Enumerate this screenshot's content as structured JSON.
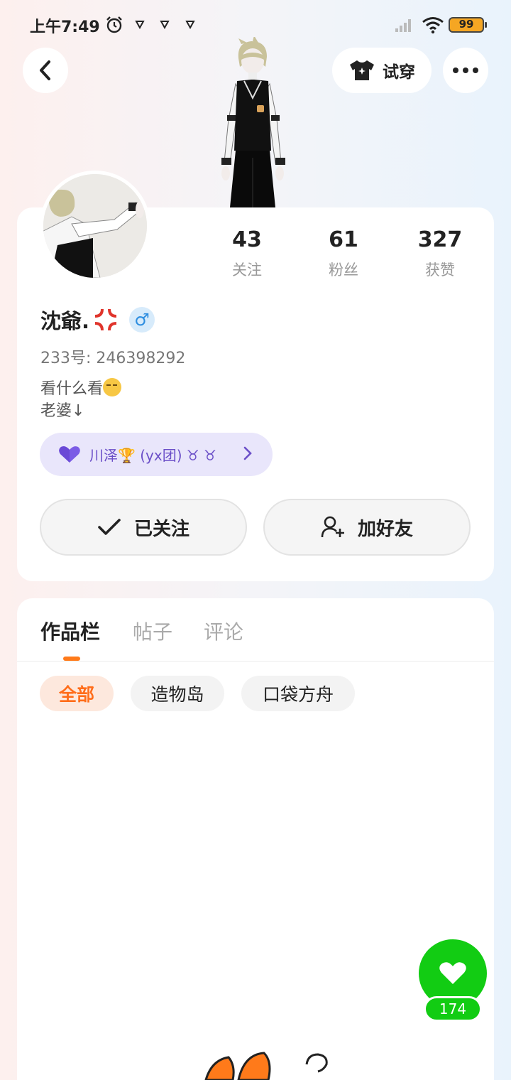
{
  "status_bar": {
    "time": "上午7:49",
    "battery": "99"
  },
  "header": {
    "tryon_label": "试穿"
  },
  "profile": {
    "stats": [
      {
        "value": "43",
        "label": "关注"
      },
      {
        "value": "61",
        "label": "粉丝"
      },
      {
        "value": "327",
        "label": "获赞"
      }
    ],
    "username": "沈爺.",
    "gender_symbol": "♂",
    "uid": "233号: 246398292",
    "bio_line1": "看什么看",
    "bio_line2": "老婆↓",
    "relation_tag": "川泽🏆 (yx团) ♉︎ ♉︎",
    "follow_label": "已关注",
    "add_friend_label": "加好友"
  },
  "works": {
    "tabs": [
      "作品栏",
      "帖子",
      "评论"
    ],
    "chips": [
      "全部",
      "造物岛",
      "口袋方舟"
    ]
  },
  "like": {
    "count": "174"
  },
  "colors": {
    "accent": "#ff7a1a",
    "like_green": "#12cc13",
    "tag_purple": "#6b4fc8"
  }
}
